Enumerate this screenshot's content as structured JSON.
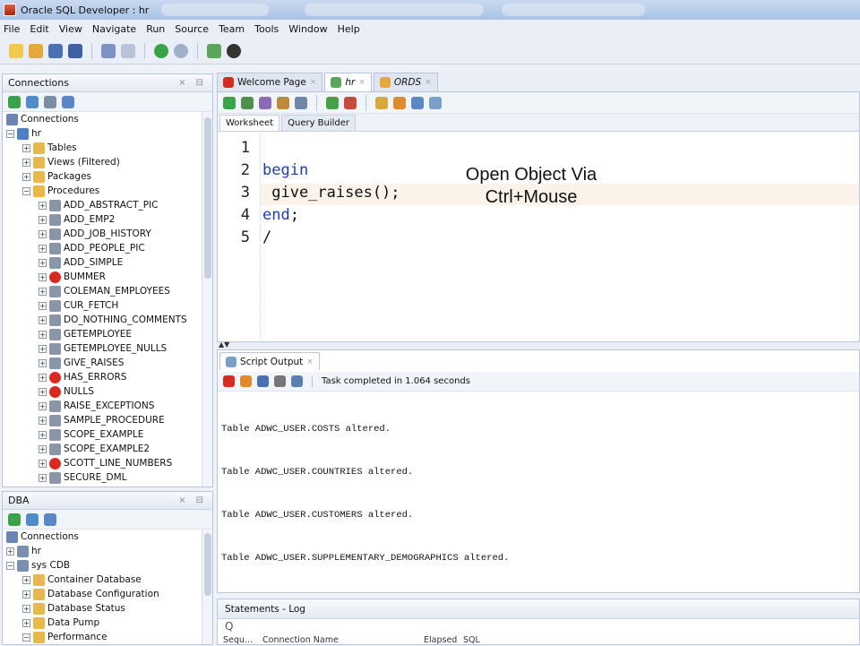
{
  "window": {
    "title": "Oracle SQL Developer : hr"
  },
  "menu": [
    "File",
    "Edit",
    "View",
    "Navigate",
    "Run",
    "Source",
    "Team",
    "Tools",
    "Window",
    "Help"
  ],
  "connections_panel": {
    "title": "Connections",
    "items": [
      {
        "label": "Connections",
        "depth": 0,
        "exp": "",
        "icon": "connections-icon"
      },
      {
        "label": "hr",
        "depth": 0,
        "exp": "-",
        "icon": "db-connection-icon"
      },
      {
        "label": "Tables",
        "depth": 1,
        "exp": "+",
        "icon": "folder-icon"
      },
      {
        "label": "Views (Filtered)",
        "depth": 1,
        "exp": "+",
        "icon": "folder-icon"
      },
      {
        "label": "Packages",
        "depth": 1,
        "exp": "+",
        "icon": "folder-icon"
      },
      {
        "label": "Procedures",
        "depth": 1,
        "exp": "-",
        "icon": "folder-icon"
      },
      {
        "label": "ADD_ABSTRACT_PIC",
        "depth": 2,
        "exp": "+",
        "icon": "procedure-icon"
      },
      {
        "label": "ADD_EMP2",
        "depth": 2,
        "exp": "+",
        "icon": "procedure-icon"
      },
      {
        "label": "ADD_JOB_HISTORY",
        "depth": 2,
        "exp": "+",
        "icon": "procedure-icon"
      },
      {
        "label": "ADD_PEOPLE_PIC",
        "depth": 2,
        "exp": "+",
        "icon": "procedure-icon"
      },
      {
        "label": "ADD_SIMPLE",
        "depth": 2,
        "exp": "+",
        "icon": "procedure-icon"
      },
      {
        "label": "BUMMER",
        "depth": 2,
        "exp": "+",
        "icon": "error-procedure-icon"
      },
      {
        "label": "COLEMAN_EMPLOYEES",
        "depth": 2,
        "exp": "+",
        "icon": "procedure-icon"
      },
      {
        "label": "CUR_FETCH",
        "depth": 2,
        "exp": "+",
        "icon": "procedure-icon"
      },
      {
        "label": "DO_NOTHING_COMMENTS",
        "depth": 2,
        "exp": "+",
        "icon": "procedure-icon"
      },
      {
        "label": "GETEMPLOYEE",
        "depth": 2,
        "exp": "+",
        "icon": "procedure-icon"
      },
      {
        "label": "GETEMPLOYEE_NULLS",
        "depth": 2,
        "exp": "+",
        "icon": "procedure-icon"
      },
      {
        "label": "GIVE_RAISES",
        "depth": 2,
        "exp": "+",
        "icon": "procedure-icon"
      },
      {
        "label": "HAS_ERRORS",
        "depth": 2,
        "exp": "+",
        "icon": "error-procedure-icon"
      },
      {
        "label": "NULLS",
        "depth": 2,
        "exp": "+",
        "icon": "error-procedure-icon"
      },
      {
        "label": "RAISE_EXCEPTIONS",
        "depth": 2,
        "exp": "+",
        "icon": "procedure-icon"
      },
      {
        "label": "SAMPLE_PROCEDURE",
        "depth": 2,
        "exp": "+",
        "icon": "procedure-icon"
      },
      {
        "label": "SCOPE_EXAMPLE",
        "depth": 2,
        "exp": "+",
        "icon": "procedure-icon"
      },
      {
        "label": "SCOPE_EXAMPLE2",
        "depth": 2,
        "exp": "+",
        "icon": "procedure-icon"
      },
      {
        "label": "SCOTT_LINE_NUMBERS",
        "depth": 2,
        "exp": "+",
        "icon": "error-procedure-icon"
      },
      {
        "label": "SECURE_DML",
        "depth": 2,
        "exp": "+",
        "icon": "procedure-icon"
      }
    ]
  },
  "dba_panel": {
    "title": "DBA",
    "items": [
      {
        "label": "Connections",
        "depth": 0,
        "exp": "",
        "icon": "connections-icon"
      },
      {
        "label": "hr",
        "depth": 0,
        "exp": "+",
        "icon": "database-icon"
      },
      {
        "label": "sys CDB",
        "depth": 0,
        "exp": "-",
        "icon": "database-icon"
      },
      {
        "label": "Container Database",
        "depth": 1,
        "exp": "+",
        "icon": "folder-icon"
      },
      {
        "label": "Database Configuration",
        "depth": 1,
        "exp": "+",
        "icon": "folder-icon"
      },
      {
        "label": "Database Status",
        "depth": 1,
        "exp": "+",
        "icon": "folder-icon"
      },
      {
        "label": "Data Pump",
        "depth": 1,
        "exp": "+",
        "icon": "folder-icon"
      },
      {
        "label": "Performance",
        "depth": 1,
        "exp": "-",
        "icon": "folder-icon"
      }
    ]
  },
  "editor_tabs": [
    {
      "label": "Welcome Page",
      "icon": "oracle-icon",
      "active": false,
      "italic": false
    },
    {
      "label": "hr",
      "icon": "sql-worksheet-icon",
      "active": true,
      "italic": true
    },
    {
      "label": "ORDS",
      "icon": "ords-icon",
      "active": false,
      "italic": true
    }
  ],
  "worksheet_tabs": [
    "Worksheet",
    "Query Builder"
  ],
  "code_lines": [
    {
      "n": "1",
      "parts": []
    },
    {
      "n": "2",
      "parts": [
        {
          "t": "begin",
          "kw": true
        }
      ]
    },
    {
      "n": "3",
      "parts": [
        {
          "t": " give_raises();",
          "kw": false
        }
      ]
    },
    {
      "n": "4",
      "parts": [
        {
          "t": "end",
          "kw": true
        },
        {
          "t": ";",
          "kw": false
        }
      ]
    },
    {
      "n": "5",
      "parts": [
        {
          "t": "/",
          "kw": false
        }
      ]
    }
  ],
  "overlay_text": [
    "Open Object Via",
    "Ctrl+Mouse"
  ],
  "script_output": {
    "tab_label": "Script Output",
    "status": "Task completed in 1.064 seconds",
    "lines": [
      "Table ADWC_USER.COSTS altered.",
      "Table ADWC_USER.COUNTRIES altered.",
      "Table ADWC_USER.CUSTOMERS altered.",
      "Table ADWC_USER.SUPPLEMENTARY_DEMOGRAPHICS altered."
    ]
  },
  "statements_log": {
    "title": "Statements - Log",
    "search_icon": "Q",
    "columns": [
      "Sequ...",
      "Connection Name",
      "Elapsed",
      "SQL"
    ]
  },
  "colors": {
    "accent": "#1e3fa8",
    "error": "#d82a20",
    "highlight": "#fbf3ea"
  }
}
